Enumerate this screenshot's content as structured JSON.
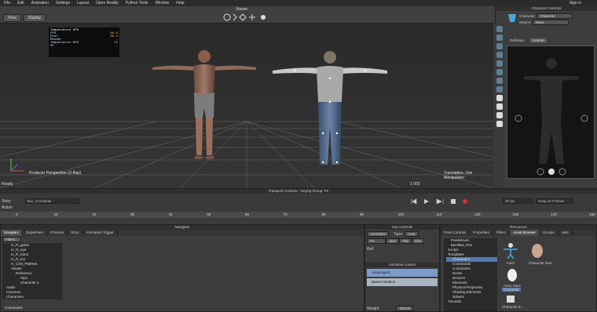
{
  "menubar": {
    "items": [
      "File",
      "Edit",
      "Animation",
      "Settings",
      "Layout",
      "Open Reality",
      "Python Tools",
      "Window",
      "Help"
    ],
    "sign_in": "Sign in"
  },
  "viewer": {
    "title": "Viewer",
    "view_btn": "View",
    "display_btn": "Display",
    "perspective_label": "Producer Perspective (X-Ray)",
    "mode_label": "Translation, Use Manipulator",
    "ready": "Ready",
    "frame_info": "1 000",
    "hud": {
      "title": "Temperature GPU",
      "rows": [
        {
          "k": "FPS",
          "v": "80.0"
        },
        {
          "k": "Eval",
          "v": "68.2"
        },
        {
          "k": "Render",
          "v": "—"
        },
        {
          "k": "Temperature GPU",
          "v": "25"
        },
        {
          "k": "SI",
          "v": "—"
        }
      ]
    }
  },
  "character_controls": {
    "title": "Character Controls",
    "character_label": "Character:",
    "character_value": "Character",
    "source_label": "Source:",
    "source_value": "None",
    "tabs": [
      "Definition",
      "Controls"
    ]
  },
  "transport": {
    "title": "Transport Controls - Keying Group: FK",
    "story_label": "Story",
    "action_label": "Action",
    "take_value": "Box_Crossbrak",
    "fps_value": "30 fps",
    "snap_value": "Snap on Frames",
    "timeline_ticks": [
      "0",
      "10",
      "20",
      "30",
      "40",
      "50",
      "60",
      "70",
      "80",
      "90",
      "100",
      "110",
      "120",
      "130",
      "140",
      "150"
    ]
  },
  "navigator": {
    "title": "Navigator",
    "tabs": [
      "Navigator",
      "Dopesheet",
      "FCurves",
      "Story",
      "Animation Trigger"
    ],
    "filters_label": "Filters...",
    "tree": [
      "m_R_gaine",
      "m_R_eye",
      "m_R_trans",
      "m_R_tou",
      "H_CO5_PMiRes",
      "Viewer",
      "Reference",
      "Hips",
      "Character 2",
      "Audio",
      "Cameras",
      "Characters",
      "Constraints"
    ]
  },
  "key_controls": {
    "title": "Key Controls",
    "animation_label": "Animation",
    "type_label": "Type:",
    "type_value": "Auto",
    "zero_label": "Zero",
    "flat_label": "Flat",
    "cha_label": "Cha",
    "fk_value": "FK",
    "ref_label": "Ref:",
    "layers_title": "Animation Layers",
    "layers": [
      "AnimLayer1",
      "BaseAnimation"
    ],
    "weight_label": "Weight",
    "weight_value": "100.00"
  },
  "resources": {
    "title": "Resources",
    "tabs": [
      "Pose Controls",
      "Properties",
      "Filters",
      "Asset Browser",
      "Groups",
      "Sets"
    ],
    "tree": [
      "PreviMoves",
      "BackBut_Rim",
      "Scripts",
      "Templates",
      "Characters",
      "Commands",
      "Constraints",
      "Decks",
      "Devices",
      "Elements",
      "Physical Properties",
      "Shading Elements",
      "Solvers",
      "Tutorials"
    ],
    "assets": [
      "Actor",
      "Character face",
      "Actor Face",
      "Character",
      "Character E..."
    ]
  }
}
